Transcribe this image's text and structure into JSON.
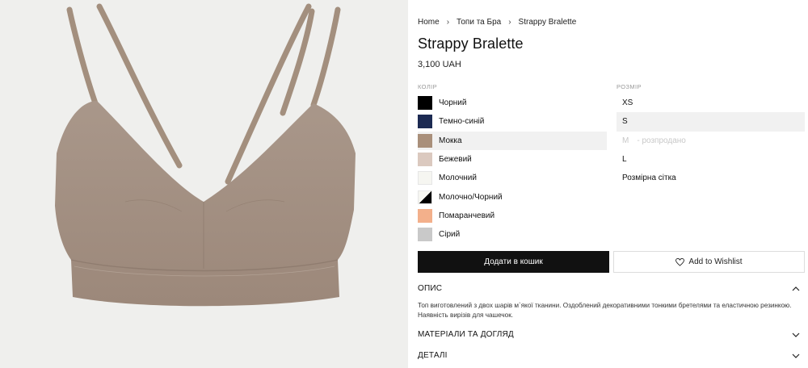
{
  "breadcrumb": [
    "Home",
    "Топи та Бра",
    "Strappy Bralette"
  ],
  "product": {
    "title": "Strappy Bralette",
    "price": "3,100 UAH"
  },
  "colors": {
    "label": "КОЛІР",
    "selected": "Мокка",
    "options": [
      {
        "name": "Чорний",
        "hex": "#000000"
      },
      {
        "name": "Темно-синій",
        "hex": "#1c2a52"
      },
      {
        "name": "Мокка",
        "hex": "#a98f7a"
      },
      {
        "name": "Бежевий",
        "hex": "#dbc9bf"
      },
      {
        "name": "Молочний",
        "hex": "#f6f6f1"
      },
      {
        "name": "Молочно/Чорний",
        "hex": "#f6f6f1",
        "hex2": "#000000"
      },
      {
        "name": "Помаранчевий",
        "hex": "#f3b08b"
      },
      {
        "name": "Сірий",
        "hex": "#c9c9c9"
      }
    ]
  },
  "sizes": {
    "label": "РОЗМІР",
    "selected": "S",
    "options": [
      {
        "name": "XS",
        "soldout": false,
        "note": ""
      },
      {
        "name": "S",
        "soldout": false,
        "note": ""
      },
      {
        "name": "M",
        "soldout": true,
        "note": "- розпродано"
      },
      {
        "name": "L",
        "soldout": false,
        "note": ""
      }
    ],
    "chart_link": "Розмірна сітка"
  },
  "actions": {
    "add_to_cart": "Додати в кошик",
    "add_to_wishlist": "Add to Wishlist"
  },
  "accordion": {
    "description": {
      "title": "ОПИС",
      "text": "Топ виготовлений з двох шарів м`якої тканини. Оздоблений декоративними тонкими бретелями та еластичною резинкою. Наявність вирізів для чашечок."
    },
    "materials": {
      "title": "МАТЕРІАЛИ ТА ДОГЛЯД"
    },
    "details": {
      "title": "ДЕТАЛІ"
    }
  },
  "theme": {
    "product_color": "#a38f7e",
    "image_bg": "#efefed",
    "button_dark": "#111111"
  }
}
